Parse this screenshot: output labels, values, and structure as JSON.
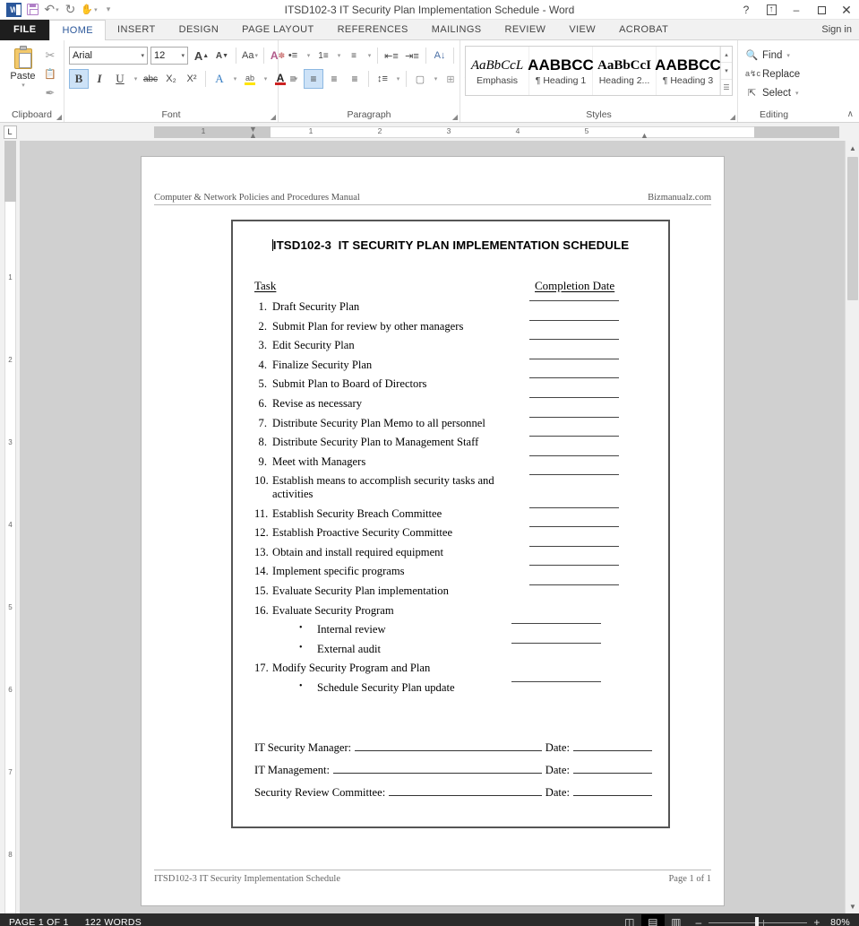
{
  "window": {
    "title": "ITSD102-3 IT Security Plan Implementation Schedule - Word",
    "quick_access": [
      {
        "name": "word-logo",
        "label": "W"
      },
      {
        "name": "save-icon",
        "label": ""
      },
      {
        "name": "undo-icon",
        "label": "↶"
      },
      {
        "name": "redo-icon",
        "label": "↻"
      },
      {
        "name": "touch-mode-icon",
        "label": "✋"
      },
      {
        "name": "customize-qat-icon",
        "label": "▾"
      }
    ],
    "controls": {
      "help": "?",
      "ribbon_display": "⬆",
      "minimize": "–",
      "maximize": "❐",
      "close": "✕"
    }
  },
  "tabs": {
    "file": "FILE",
    "items": [
      "HOME",
      "INSERT",
      "DESIGN",
      "PAGE LAYOUT",
      "REFERENCES",
      "MAILINGS",
      "REVIEW",
      "VIEW",
      "ACROBAT"
    ],
    "active": "HOME",
    "sign_in": "Sign in"
  },
  "ribbon": {
    "clipboard": {
      "label": "Clipboard",
      "paste": "Paste",
      "paste_caret": "▾",
      "cut": "✂",
      "copy": "❐",
      "format_painter": "✒",
      "launcher": "◢"
    },
    "font": {
      "label": "Font",
      "font_name": "Arial",
      "font_size": "12",
      "grow_font": "A",
      "shrink_font": "A",
      "change_case": "Aa",
      "clear_formatting": "A",
      "bold": "B",
      "italic": "I",
      "underline": "U",
      "strikethrough": "abc",
      "subscript": "X₂",
      "superscript": "X²",
      "text_effects": "A",
      "highlight": "ab",
      "font_color": "A",
      "caret": "▾",
      "launcher": "◢"
    },
    "paragraph": {
      "label": "Paragraph",
      "bullets": "•≡",
      "numbering": "1≡",
      "multilevel": "≡",
      "decrease_indent": "⇤",
      "increase_indent": "⇥",
      "sort": "A↓",
      "show_marks": "¶",
      "align_left": "≡",
      "align_center": "≡",
      "align_right": "≡",
      "justify": "≡",
      "line_spacing": "↕≡",
      "shading": "□",
      "borders": "⊞",
      "caret": "▾",
      "launcher": "◢"
    },
    "styles": {
      "label": "Styles",
      "launcher": "◢",
      "items": [
        {
          "preview": "AaBbCcL",
          "name": "Emphasis",
          "font": "serif-italic"
        },
        {
          "preview": "AABBCC",
          "name": "¶ Heading 1",
          "font": "sans-bold"
        },
        {
          "preview": "AaBbCcI",
          "name": "Heading 2...",
          "font": "serif-bold"
        },
        {
          "preview": "AABBCC",
          "name": "¶ Heading 3",
          "font": "sans-bold"
        }
      ],
      "scroll_up": "▴",
      "scroll_down": "▾",
      "more": "≡"
    },
    "editing": {
      "label": "Editing",
      "find": "Find",
      "replace": "Replace",
      "select": "Select",
      "find_caret": "▾",
      "select_caret": "▾",
      "find_icon": "🔍",
      "replace_icon": "ab",
      "select_icon": "↖"
    },
    "collapse": "∧"
  },
  "ruler": {
    "tab_stop": "L",
    "h_numbers": [
      "1",
      "1",
      "2",
      "3",
      "4",
      "5"
    ],
    "v_numbers": [
      "1",
      "2",
      "3",
      "4",
      "5",
      "6",
      "7",
      "8"
    ]
  },
  "document": {
    "header": {
      "left": "Computer & Network Policies and Procedures Manual",
      "right": "Bizmanualz.com"
    },
    "title_code": "ITSD102-3",
    "title_text": "IT SECURITY PLAN IMPLEMENTATION SCHEDULE",
    "columns": {
      "task": "Task",
      "completion_date": "Completion Date"
    },
    "tasks": [
      {
        "num": "1.",
        "text": "Draft Security Plan",
        "line": true
      },
      {
        "num": "2.",
        "text": "Submit Plan for review by other managers",
        "line": true
      },
      {
        "num": "3.",
        "text": "Edit Security Plan",
        "line": true
      },
      {
        "num": "4.",
        "text": "Finalize Security Plan",
        "line": true
      },
      {
        "num": "5.",
        "text": "Submit Plan to Board of Directors",
        "line": true
      },
      {
        "num": "6.",
        "text": "Revise as necessary",
        "line": true
      },
      {
        "num": "7.",
        "text": "Distribute Security Plan Memo to all personnel",
        "line": true
      },
      {
        "num": "8.",
        "text": "Distribute Security Plan to Management Staff",
        "line": true
      },
      {
        "num": "9.",
        "text": "Meet with Managers",
        "line": true
      },
      {
        "num": "10.",
        "text": "Establish means to accomplish security tasks and activities",
        "line": true
      },
      {
        "num": "11.",
        "text": "Establish Security Breach Committee",
        "line": true
      },
      {
        "num": "12.",
        "text": "Establish Proactive Security Committee",
        "line": true
      },
      {
        "num": "13.",
        "text": "Obtain and install required equipment",
        "line": true
      },
      {
        "num": "14.",
        "text": "Implement specific programs",
        "line": true
      },
      {
        "num": "15.",
        "text": "Evaluate Security Plan implementation",
        "line": true
      },
      {
        "num": "16.",
        "text": "Evaluate Security Program",
        "line": false
      },
      {
        "num": "•",
        "text": "Internal review",
        "line": true,
        "sub": true
      },
      {
        "num": "•",
        "text": "External audit",
        "line": true,
        "sub": true
      },
      {
        "num": "17.",
        "text": "Modify Security Program and Plan",
        "line": false
      },
      {
        "num": "•",
        "text": "Schedule Security Plan update",
        "line": true,
        "sub": true
      }
    ],
    "signatures": [
      {
        "label": "IT Security Manager:",
        "date_label": "Date:"
      },
      {
        "label": "IT Management:",
        "date_label": "Date:"
      },
      {
        "label": "Security Review Committee:",
        "date_label": "Date:"
      }
    ],
    "footer": {
      "left": "ITSD102-3 IT Security Implementation Schedule",
      "right": "Page 1 of 1"
    }
  },
  "status_bar": {
    "page": "PAGE 1 OF 1",
    "words": "122 WORDS",
    "views": [
      {
        "name": "read-mode-view",
        "glyph": "◫",
        "selected": false
      },
      {
        "name": "print-layout-view",
        "glyph": "▤",
        "selected": true
      },
      {
        "name": "web-layout-view",
        "glyph": "▥",
        "selected": false
      }
    ],
    "zoom_out": "–",
    "zoom_in": "+",
    "zoom_level": "80%"
  },
  "colors": {
    "accent": "#2b579a",
    "titlebar_bg": "#ffffff",
    "ribbon_bg": "#ffffff",
    "workspace_bg": "#d0d0d0",
    "statusbar_bg": "#2b2b2b"
  }
}
